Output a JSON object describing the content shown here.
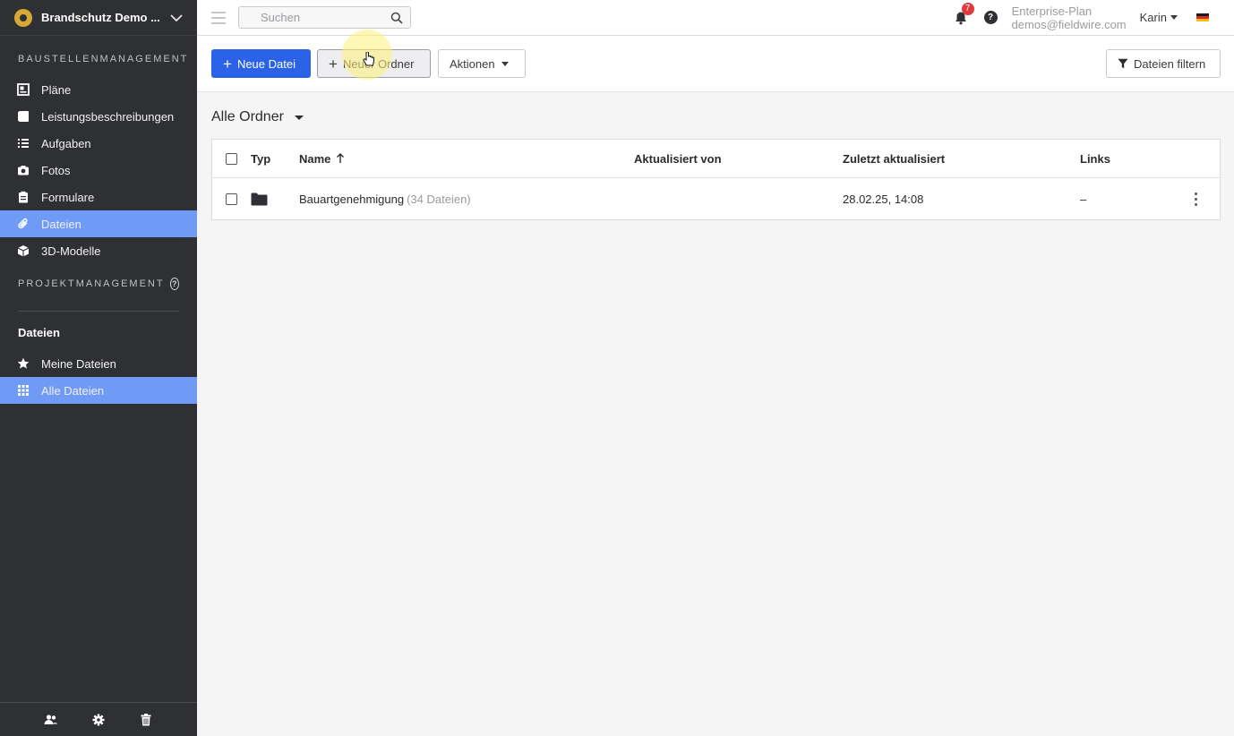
{
  "sidebar": {
    "project_name": "Brandschutz Demo ...",
    "section_baustelle": "BAUSTELLENMANAGEMENT",
    "nav_items": [
      {
        "label": "Pläne",
        "icon": "plans-icon"
      },
      {
        "label": "Leistungsbeschreibungen",
        "icon": "specifications-icon"
      },
      {
        "label": "Aufgaben",
        "icon": "tasks-list-icon"
      },
      {
        "label": "Fotos",
        "icon": "camera-icon"
      },
      {
        "label": "Formulare",
        "icon": "clipboard-icon"
      },
      {
        "label": "Dateien",
        "icon": "paperclip-icon",
        "active": true
      },
      {
        "label": "3D-Modelle",
        "icon": "cube-icon"
      }
    ],
    "section_projekt": "PROJEKTMANAGEMENT",
    "files_title": "Dateien",
    "file_items": [
      {
        "label": "Meine Dateien",
        "icon": "star-icon"
      },
      {
        "label": "Alle Dateien",
        "icon": "grid-icon",
        "active": true
      }
    ],
    "footer_icons": [
      "people-icon",
      "gear-icon",
      "trash-icon"
    ]
  },
  "topbar": {
    "search_placeholder": "Suchen",
    "notification_count": "7",
    "plan_name": "Enterprise-Plan",
    "email": "demos@fieldwire.com",
    "user_name": "Karin",
    "language_flag": "german-flag-icon"
  },
  "toolbar": {
    "new_file_label": "Neue Datei",
    "new_folder_label": "Neuer Ordner",
    "actions_label": "Aktionen",
    "filter_label": "Dateien filtern"
  },
  "content": {
    "folder_dropdown": "Alle Ordner",
    "columns": {
      "type": "Typ",
      "name": "Name",
      "updated_by": "Aktualisiert von",
      "last_updated": "Zuletzt aktualisiert",
      "links": "Links"
    },
    "rows": [
      {
        "type_icon": "folder-icon",
        "name": "Bauartgenehmigung",
        "count": "(34 Dateien)",
        "updated_by": "",
        "last_updated": "28.02.25, 14:08",
        "links": "–"
      }
    ]
  },
  "colors": {
    "sidebar_bg": "#2f3033",
    "active_nav": "#6f9af5",
    "primary_button": "#2a62e8",
    "badge": "#e0393e"
  }
}
